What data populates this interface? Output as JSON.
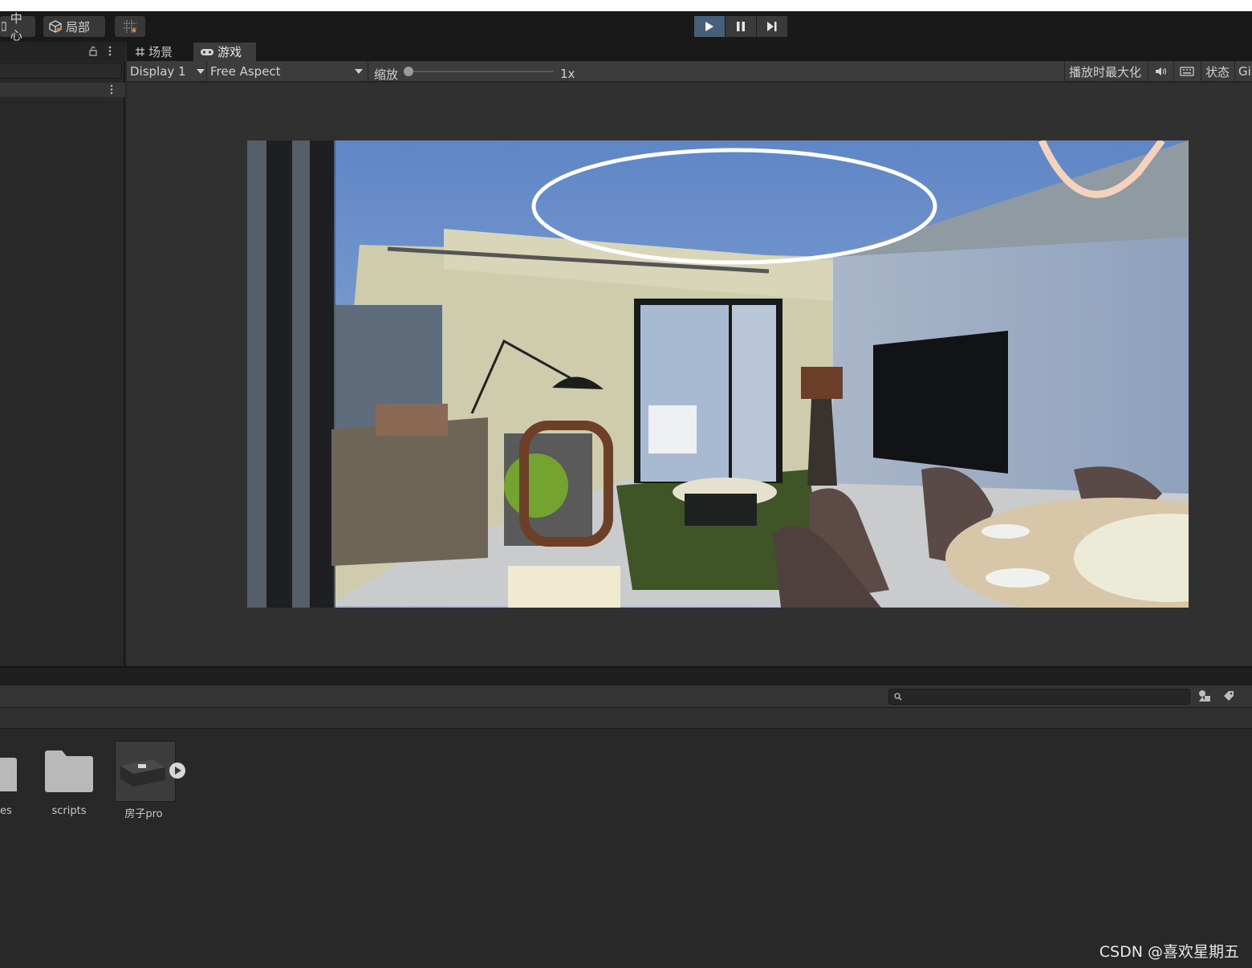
{
  "toolbar": {
    "center_label": "中心",
    "local_label": "局部"
  },
  "tabs": {
    "scene_label": "场景",
    "game_label": "游戏"
  },
  "game_bar": {
    "display_label": "Display 1",
    "aspect_label": "Free Aspect",
    "scale_label": "缩放",
    "scale_value": "1x",
    "maximize_label": "播放时最大化",
    "stats_label": "状态",
    "gizmos_label": "Gi"
  },
  "project": {
    "assets": [
      {
        "label": "es",
        "icon": "folder-icon"
      },
      {
        "label": "scripts",
        "icon": "folder-icon"
      },
      {
        "label": "房子pro",
        "icon": "model-prefab-icon"
      }
    ]
  },
  "watermark": "CSDN @喜欢星期五"
}
